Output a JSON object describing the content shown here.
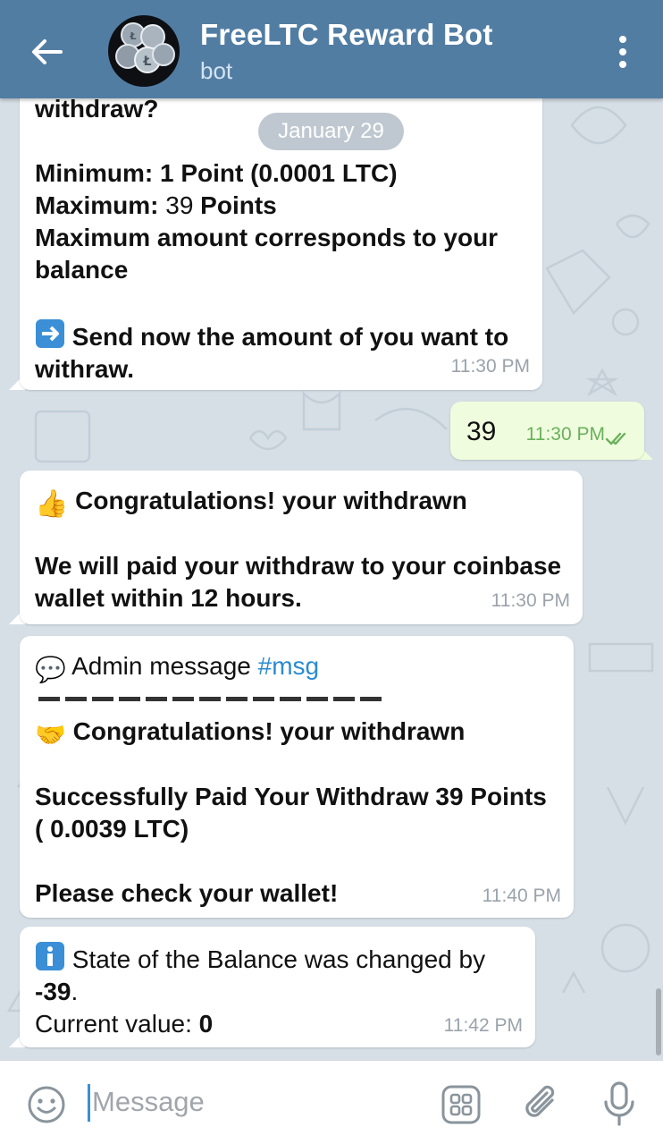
{
  "header": {
    "title": "FreeLTC Reward Bot",
    "subtitle": "bot",
    "back_icon": "arrow-left-icon",
    "menu_icon": "kebab-menu-icon"
  },
  "date_pill": "January 29",
  "messages": [
    {
      "direction": "in",
      "lines": {
        "l0": "withdraw?",
        "l1a": "Minimum: 1 Point (0.0001 LTC)",
        "l2a": "Maximum: ",
        "l2b": "39",
        "l2c": " Points",
        "l3": "Maximum amount corresponds to your",
        "l4": "balance",
        "l5": "Send now the amount of  you want to",
        "l6": "withraw."
      },
      "time": "11:30 PM"
    },
    {
      "direction": "out",
      "text": "39",
      "time": "11:30 PM",
      "status": "read"
    },
    {
      "direction": "in",
      "lines": {
        "l1": "Congratulations! your withdrawn",
        "l2": "We will paid your withdraw to your coinbase",
        "l3": "wallet within 12 hours."
      },
      "time": "11:30 PM"
    },
    {
      "direction": "in",
      "lines": {
        "l1a": "Admin message ",
        "l1b": "#msg",
        "l2": "Congratulations! your withdrawn",
        "l3": "Successfully Paid Your Withdraw 39 Points",
        "l4": "( 0.0039 LTC)",
        "l5": "Please check your wallet!"
      },
      "time": "11:40 PM"
    },
    {
      "direction": "in",
      "lines": {
        "l1": "State of the Balance was changed by",
        "l2a": "-39",
        "l2b": ".",
        "l3a": "Current value: ",
        "l3b": "0"
      },
      "time": "11:42 PM"
    }
  ],
  "input": {
    "placeholder": "Message"
  },
  "colors": {
    "header": "#527da3",
    "outgoing_bubble": "#effdde",
    "incoming_bubble": "#ffffff",
    "link": "#2b8bd0"
  }
}
